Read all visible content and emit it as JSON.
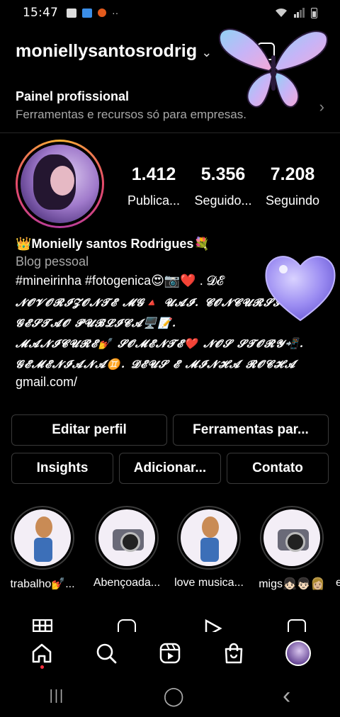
{
  "status_bar": {
    "time": "15:47",
    "left_icons": [
      "gallery-icon",
      "app-icon",
      "notification-icon"
    ],
    "dots": "··",
    "right_icons": [
      "wifi-icon",
      "signal-icon",
      "battery-icon"
    ]
  },
  "header": {
    "username": "moniellysantosrodrig",
    "chevron": "⌄",
    "icons": [
      "add-content-icon",
      "butterfly-sticker"
    ]
  },
  "professional_panel": {
    "title": "Painel profissional",
    "subtitle": "Ferramentas e recursos só para empresas.",
    "arrow": "›"
  },
  "profile": {
    "stats": [
      {
        "value": "1.412",
        "label": "Publica..."
      },
      {
        "value": "5.356",
        "label": "Seguido..."
      },
      {
        "value": "7.208",
        "label": "Seguindo"
      }
    ],
    "name": "👑Monielly santos Rodrigues💐",
    "category": "Blog pessoal",
    "bio_lines": [
      "#mineirinha #fotogenica😍📷❤️ . 𝓓𝓔",
      "𝓝𝓞𝓥𝓞𝓡𝓘𝓩𝓞𝓝𝓣𝓔 𝓜𝓖🔺 𝓤𝓐𝓘. 𝓒𝓞𝓝𝓒𝓤𝓡𝓢𝓘",
      "𝓖𝓔𝓢𝓣𝓐𝓞 𝓟𝓤𝓑𝓛𝓘𝓒𝓐🖥️📝.",
      "𝓜𝓐𝓝𝓘𝓒𝓤𝓡𝓔💅 𝓢𝓞𝓜𝓔𝓝𝓣𝓔❤️ 𝓝𝓞𝓢 𝓢𝓣𝓞𝓡𝓨📲.",
      "𝓖𝓔𝓜𝓔𝓝𝓘𝓐𝓝𝓐♊. 𝓓𝓔𝓤𝓢 𝓔 𝓜𝓘𝓝𝓗𝓐 𝓡𝓞𝓒𝓗𝓐",
      "gmail.com/"
    ]
  },
  "buttons": {
    "edit_profile": "Editar perfil",
    "tools": "Ferramentas par...",
    "insights": "Insights",
    "add": "Adicionar...",
    "contact": "Contato"
  },
  "highlights": [
    {
      "label": "trabalho💅...",
      "image": "girl"
    },
    {
      "label": "Abençoada...",
      "image": "camera"
    },
    {
      "label": "love musica...",
      "image": "girl"
    },
    {
      "label": "migs👧🏻👦🏻👩🏼",
      "image": "camera"
    }
  ],
  "highlight_overflow": "e",
  "profile_tabs": [
    "grid-icon",
    "reels-tab-icon",
    "video-tab-icon",
    "tagged-tab-icon"
  ],
  "bottom_nav": [
    "home-icon",
    "search-icon",
    "reels-icon",
    "shop-icon",
    "profile-avatar"
  ],
  "system_nav": {
    "recents": "|||",
    "home": "◯",
    "back": "‹"
  },
  "colors": {
    "background": "#000000",
    "secondary_text": "#a8a8a8",
    "button_border": "#3a3a3a",
    "notification_dot": "#ff3040"
  }
}
